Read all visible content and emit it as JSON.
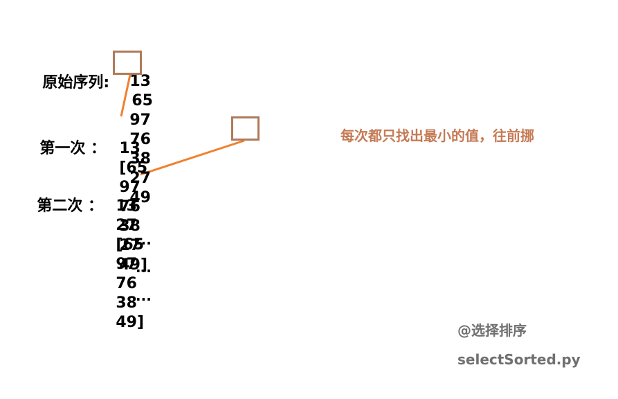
{
  "colors": {
    "highlight_box": "#b07a5a",
    "connector": "#f08030",
    "annotation": "#c57a55",
    "footer": "#707070",
    "text": "#000000"
  },
  "rows": [
    {
      "label": "原始序列:",
      "tokens": [
        "13",
        "65",
        "97",
        "76",
        "38",
        "27",
        "49"
      ],
      "bracket_open_index": null,
      "highlight_index": 0
    },
    {
      "label": "第一次 ：",
      "tokens": [
        "13",
        "[65",
        "97",
        "76",
        "38",
        "27",
        "49]"
      ],
      "highlight_index": 5
    },
    {
      "label": "第二次 ：",
      "tokens": [
        "13",
        "27",
        "[65",
        "97",
        "76",
        "38",
        "49]"
      ],
      "highlight_index": null
    }
  ],
  "ellipsis": [
    "...",
    "...",
    "..."
  ],
  "annotation": "每次都只找出最小的值，往前挪",
  "footer": {
    "title": "@选择排序",
    "filename": "selectSorted.py"
  }
}
